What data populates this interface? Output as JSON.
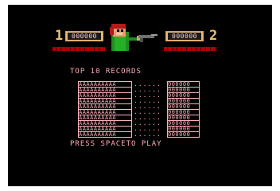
{
  "hud": {
    "player1_label": "1",
    "player2_label": "2",
    "player1_score": "000000",
    "player2_score": "000000"
  },
  "records": {
    "title": "TOP 10 RECORDS",
    "dots": "......",
    "entries": [
      {
        "name": "AAAAAAAAAA",
        "score": "000000"
      },
      {
        "name": "AAAAAAAAAA",
        "score": "000000"
      },
      {
        "name": "AAAAAAAAAA",
        "score": "000000"
      },
      {
        "name": "AAAAAAAAAA",
        "score": "000000"
      },
      {
        "name": "AAAAAAAAAA",
        "score": "000000"
      },
      {
        "name": "AAAAAAAAAA",
        "score": "000000"
      },
      {
        "name": "AAAAAAAAAA",
        "score": "000000"
      },
      {
        "name": "AAAAAAAAAA",
        "score": "000000"
      },
      {
        "name": "AAAAAAAAAA",
        "score": "000000"
      },
      {
        "name": "AAAAAAAAAA",
        "score": "000000"
      }
    ]
  },
  "prompt": "PRESS SPACETO PLAY",
  "colors": {
    "background": "#000000",
    "text": "#ffb0b8",
    "player_number": "#e8c07a",
    "health_bar": "#b00000"
  }
}
